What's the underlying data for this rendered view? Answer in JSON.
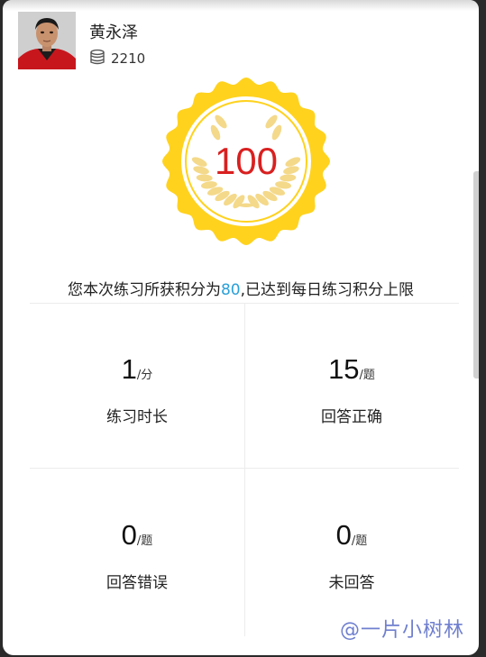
{
  "user": {
    "name": "黄永泽",
    "points": "2210",
    "icon": "coin-stack-icon"
  },
  "badge": {
    "score": "100",
    "icon": "laurel-wreath-icon",
    "colors": {
      "seal": "#ffd21e",
      "score": "#d92020"
    }
  },
  "summary": {
    "prefix": "您本次练习所获积分为",
    "earned": "80",
    "suffix": ",已达到每日练习积分上限",
    "highlight_color": "#2aa0d8"
  },
  "stats": [
    {
      "value": "1",
      "unit": "/分",
      "label": "练习时长"
    },
    {
      "value": "15",
      "unit": "/题",
      "label": "回答正确"
    },
    {
      "value": "0",
      "unit": "/题",
      "label": "回答错误"
    },
    {
      "value": "0",
      "unit": "/题",
      "label": "未回答"
    }
  ],
  "watermark": "@一片小树林"
}
